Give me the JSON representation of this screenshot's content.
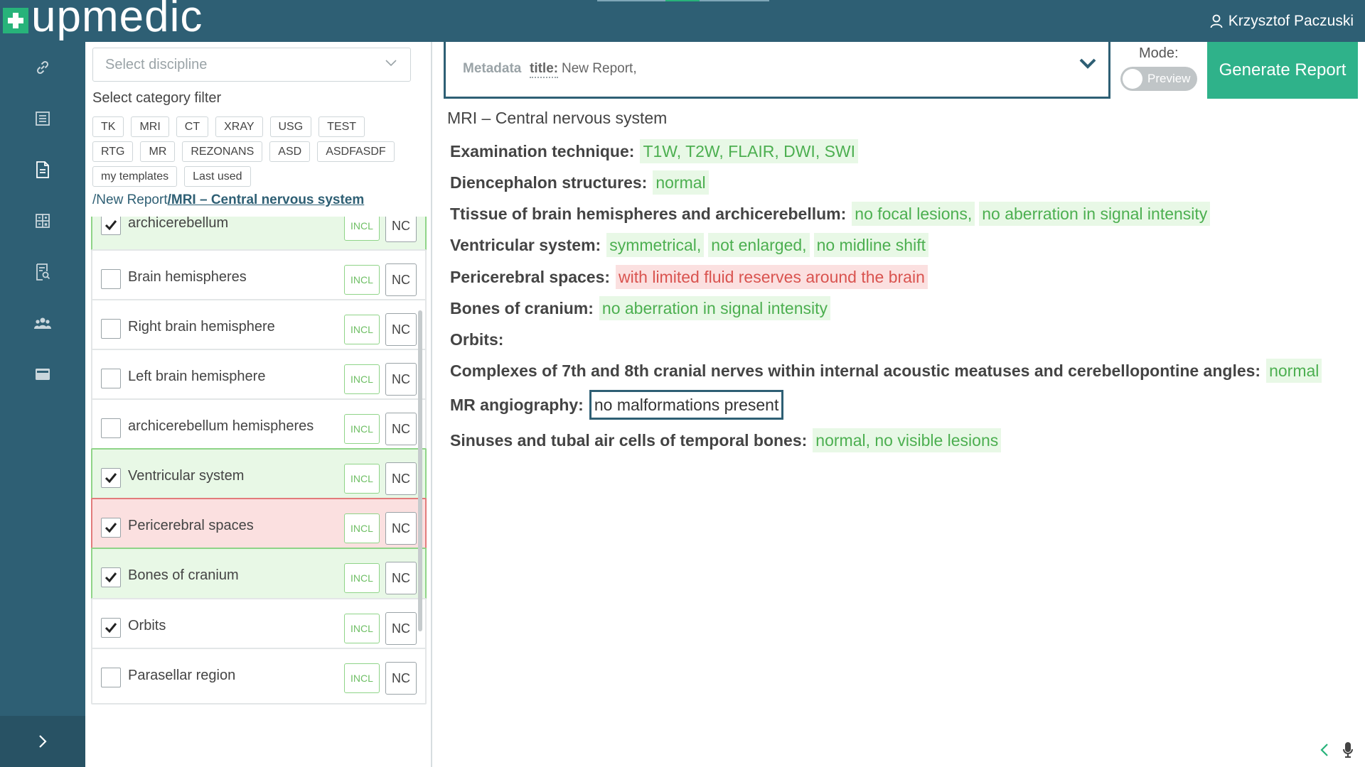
{
  "app": {
    "logo_text": "upmedic",
    "user_name": "Krzysztof Paczuski"
  },
  "colors": {
    "primary": "#2e5f74",
    "accent": "#27b37a",
    "generate_button": "#2fb28a",
    "included_bg": "#e8f8e6",
    "included_text": "#4caf50",
    "abnormal_bg": "#fbe0e0",
    "abnormal_text": "#d9534f"
  },
  "rail": {
    "icons": [
      "link-icon",
      "list-icon",
      "document-icon",
      "calculator-icon",
      "report-search-icon",
      "users-icon",
      "card-icon"
    ],
    "expand_icon": "chevron-right-icon"
  },
  "left_panel": {
    "discipline_placeholder": "Select discipline",
    "category_title": "Select category filter",
    "category_rows": [
      [
        "TK",
        "MRI",
        "CT",
        "XRAY",
        "USG",
        "TEST"
      ],
      [
        "RTG",
        "MR",
        "REZONANS",
        "ASD",
        "ASDFASDF"
      ],
      [
        "my templates",
        "Last used"
      ]
    ],
    "breadcrumb_root": "/New Report",
    "breadcrumb_current": "/MRI – Central nervous system",
    "items": [
      {
        "label": "archicerebellum",
        "checked": true,
        "state": "green"
      },
      {
        "label": "Brain hemispheres",
        "checked": false,
        "state": "none"
      },
      {
        "label": "Right brain hemisphere",
        "checked": false,
        "state": "none"
      },
      {
        "label": "Left brain hemisphere",
        "checked": false,
        "state": "none"
      },
      {
        "label": "archicerebellum hemispheres",
        "checked": false,
        "state": "none"
      },
      {
        "label": "Ventricular system",
        "checked": true,
        "state": "green"
      },
      {
        "label": "Pericerebral spaces",
        "checked": true,
        "state": "red"
      },
      {
        "label": "Bones of cranium",
        "checked": true,
        "state": "green"
      },
      {
        "label": "Orbits",
        "checked": true,
        "state": "none"
      },
      {
        "label": "Parasellar region",
        "checked": false,
        "state": "none"
      }
    ],
    "incl_label": "INCL",
    "nc_label": "NC"
  },
  "metadata": {
    "label": "Metadata",
    "key": "title:",
    "value": "New Report,"
  },
  "mode": {
    "label": "Mode:",
    "toggle_text": "Preview",
    "enabled": false
  },
  "generate_label": "Generate Report",
  "report": {
    "title": "MRI – Central nervous system",
    "rows": [
      {
        "label": "Examination technique:",
        "values": [
          {
            "text": "T1W, T2W, FLAIR, DWI, SWI",
            "kind": "ok"
          }
        ]
      },
      {
        "label": "Diencephalon structures:",
        "values": [
          {
            "text": "normal",
            "kind": "ok"
          }
        ]
      },
      {
        "label": "Ttissue of brain hemispheres and archicerebellum:",
        "values": [
          {
            "text": "no focal lesions,",
            "kind": "ok"
          },
          {
            "text": "no aberration in signal intensity",
            "kind": "ok"
          }
        ]
      },
      {
        "label": "Ventricular system:",
        "values": [
          {
            "text": "symmetrical,",
            "kind": "ok"
          },
          {
            "text": "not enlarged,",
            "kind": "ok"
          },
          {
            "text": "no midline shift",
            "kind": "ok"
          }
        ]
      },
      {
        "label": "Pericerebral spaces:",
        "values": [
          {
            "text": "with limited fluid reserves around the brain",
            "kind": "abnormal"
          }
        ]
      },
      {
        "label": "Bones of cranium:",
        "values": [
          {
            "text": "no aberration in signal intensity",
            "kind": "ok"
          }
        ]
      },
      {
        "label": "Orbits:",
        "values": []
      },
      {
        "label": "Complexes of 7th and 8th cranial nerves within internal acoustic meatuses and cerebellopontine angles:",
        "values": [
          {
            "text": "normal",
            "kind": "ok"
          }
        ]
      },
      {
        "label": "MR angiography:",
        "values": [
          {
            "text": "no malformations present",
            "kind": "input"
          }
        ]
      },
      {
        "label": "Sinuses and tubal air cells of temporal bones:",
        "values": [
          {
            "text": "normal, no visible lesions",
            "kind": "ok"
          }
        ]
      }
    ]
  }
}
